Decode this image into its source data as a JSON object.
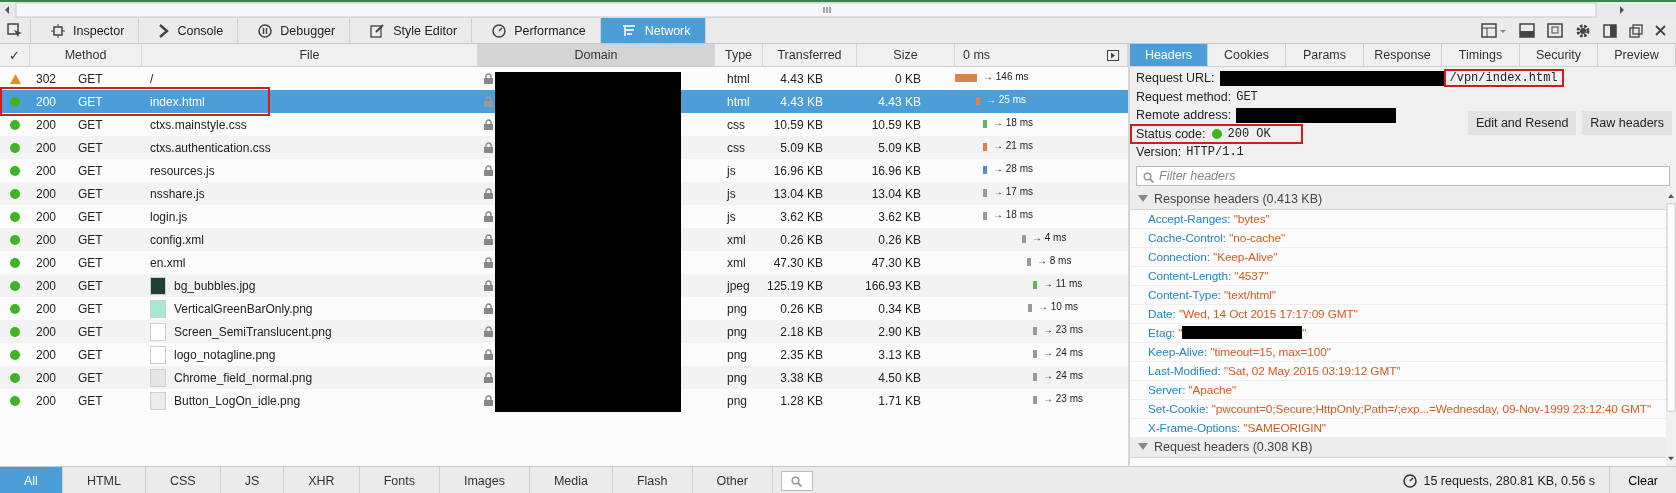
{
  "toolbar": {
    "tabs": [
      {
        "label": "Inspector",
        "selected": false
      },
      {
        "label": "Console",
        "selected": false
      },
      {
        "label": "Debugger",
        "selected": false
      },
      {
        "label": "Style Editor",
        "selected": false
      },
      {
        "label": "Performance",
        "selected": false
      },
      {
        "label": "Network",
        "selected": true
      }
    ]
  },
  "table": {
    "columns": [
      "✓",
      "Method",
      "File",
      "Domain",
      "Type",
      "Transferred",
      "Size",
      "0 ms"
    ],
    "rows": [
      {
        "status": "302",
        "kind": "redirect",
        "method": "GET",
        "file": "/",
        "type": "html",
        "transferred": "4.43 KB",
        "size": "0 KB",
        "timing": "→ 146 ms",
        "color": "#d9834a",
        "selected": false,
        "highlighted": false
      },
      {
        "status": "200",
        "kind": "ok",
        "method": "GET",
        "file": "index.html",
        "type": "html",
        "transferred": "4.43 KB",
        "size": "4.43 KB",
        "timing": "→ 25 ms",
        "color": "#d9834a",
        "selected": true,
        "highlighted": true
      },
      {
        "status": "200",
        "kind": "ok",
        "method": "GET",
        "file": "ctxs.mainstyle.css",
        "type": "css",
        "transferred": "10.59 KB",
        "size": "10.59 KB",
        "timing": "→ 18 ms",
        "color": "#5fb85c",
        "selected": false,
        "highlighted": false
      },
      {
        "status": "200",
        "kind": "ok",
        "method": "GET",
        "file": "ctxs.authentication.css",
        "type": "css",
        "transferred": "5.09 KB",
        "size": "5.09 KB",
        "timing": "→ 21 ms",
        "color": "#d9834a",
        "selected": false,
        "highlighted": false
      },
      {
        "status": "200",
        "kind": "ok",
        "method": "GET",
        "file": "resources.js",
        "type": "js",
        "transferred": "16.96 KB",
        "size": "16.96 KB",
        "timing": "→ 28 ms",
        "color": "#4f8fd0",
        "selected": false,
        "highlighted": false
      },
      {
        "status": "200",
        "kind": "ok",
        "method": "GET",
        "file": "nsshare.js",
        "type": "js",
        "transferred": "13.04 KB",
        "size": "13.04 KB",
        "timing": "→ 17 ms",
        "color": "#999999",
        "selected": false,
        "highlighted": false
      },
      {
        "status": "200",
        "kind": "ok",
        "method": "GET",
        "file": "login.js",
        "type": "js",
        "transferred": "3.62 KB",
        "size": "3.62 KB",
        "timing": "→ 18 ms",
        "color": "#999999",
        "selected": false,
        "highlighted": false
      },
      {
        "status": "200",
        "kind": "ok",
        "method": "GET",
        "file": "config.xml",
        "type": "xml",
        "transferred": "0.26 KB",
        "size": "0.26 KB",
        "timing": "→ 4 ms",
        "color": "#999999",
        "selected": false,
        "highlighted": false
      },
      {
        "status": "200",
        "kind": "ok",
        "method": "GET",
        "file": "en.xml",
        "type": "xml",
        "transferred": "47.30 KB",
        "size": "47.30 KB",
        "timing": "→ 8 ms",
        "color": "#999999",
        "selected": false,
        "highlighted": false
      },
      {
        "status": "200",
        "kind": "ok",
        "method": "GET",
        "file": "bg_bubbles.jpg",
        "thumbnail": {
          "color": "#1e4038"
        },
        "type": "jpeg",
        "transferred": "125.19 KB",
        "size": "166.93 KB",
        "timing": "→ 11 ms",
        "color": "#5fb85c",
        "selected": false,
        "highlighted": false
      },
      {
        "status": "200",
        "kind": "ok",
        "method": "GET",
        "file": "VerticalGreenBarOnly.png",
        "thumbnail": {
          "color": "#a8e8d2"
        },
        "type": "png",
        "transferred": "0.26 KB",
        "size": "0.34 KB",
        "timing": "→ 10 ms",
        "color": "#999999",
        "selected": false,
        "highlighted": false
      },
      {
        "status": "200",
        "kind": "ok",
        "method": "GET",
        "file": "Screen_SemiTranslucent.png",
        "thumbnail": {
          "color": "#ffffff"
        },
        "type": "png",
        "transferred": "2.18 KB",
        "size": "2.90 KB",
        "timing": "→ 23 ms",
        "color": "#999999",
        "selected": false,
        "highlighted": false
      },
      {
        "status": "200",
        "kind": "ok",
        "method": "GET",
        "file": "logo_notagline.png",
        "thumbnail": {
          "color": "#ffffff"
        },
        "type": "png",
        "transferred": "2.35 KB",
        "size": "3.13 KB",
        "timing": "→ 24 ms",
        "color": "#999999",
        "selected": false,
        "highlighted": false
      },
      {
        "status": "200",
        "kind": "ok",
        "method": "GET",
        "file": "Chrome_field_normal.png",
        "thumbnail": {
          "color": "#e6e6e6"
        },
        "type": "png",
        "transferred": "3.38 KB",
        "size": "4.50 KB",
        "timing": "→ 24 ms",
        "color": "#999999",
        "selected": false,
        "highlighted": false
      },
      {
        "status": "200",
        "kind": "ok",
        "method": "GET",
        "file": "Button_LogOn_idle.png",
        "thumbnail": {
          "color": "#ececec"
        },
        "type": "png",
        "transferred": "1.28 KB",
        "size": "1.71 KB",
        "timing": "→ 23 ms",
        "color": "#999999",
        "selected": false,
        "highlighted": false
      }
    ]
  },
  "filters": [
    {
      "label": "All",
      "selected": true
    },
    {
      "label": "HTML",
      "selected": false
    },
    {
      "label": "CSS",
      "selected": false
    },
    {
      "label": "JS",
      "selected": false
    },
    {
      "label": "XHR",
      "selected": false
    },
    {
      "label": "Fonts",
      "selected": false
    },
    {
      "label": "Images",
      "selected": false
    },
    {
      "label": "Media",
      "selected": false
    },
    {
      "label": "Flash",
      "selected": false
    },
    {
      "label": "Other",
      "selected": false
    }
  ],
  "details": {
    "tabs": [
      {
        "label": "Headers",
        "selected": true
      },
      {
        "label": "Cookies",
        "selected": false
      },
      {
        "label": "Params",
        "selected": false
      },
      {
        "label": "Response",
        "selected": false
      },
      {
        "label": "Timings",
        "selected": false
      },
      {
        "label": "Security",
        "selected": false
      },
      {
        "label": "Preview",
        "selected": false
      }
    ],
    "request_url": {
      "label": "Request URL:",
      "value": "/vpn/index.html",
      "highlighted": true
    },
    "request_method": {
      "label": "Request method:",
      "value": "GET"
    },
    "remote_address": {
      "label": "Remote address:"
    },
    "status_code": {
      "label": "Status code:",
      "value": "200 OK",
      "highlighted": true
    },
    "version": {
      "label": "Version:",
      "value": "HTTP/1.1"
    },
    "buttons": [
      "Edit and Resend",
      "Raw headers"
    ],
    "filter": {
      "placeholder": "Filter headers"
    },
    "response_headers": {
      "title": "Response headers (0.413 KB)",
      "expanded": true,
      "items": [
        {
          "name": "Accept-Ranges:",
          "value": "\"bytes\""
        },
        {
          "name": "Cache-Control:",
          "value": "\"no-cache\""
        },
        {
          "name": "Connection:",
          "value": "\"Keep-Alive\""
        },
        {
          "name": "Content-Length:",
          "value": "\"4537\""
        },
        {
          "name": "Content-Type:",
          "value": "\"text/html\""
        },
        {
          "name": "Date:",
          "value": "\"Wed, 14 Oct 2015 17:17:09 GMT\""
        },
        {
          "name": "Etag:",
          "value": "\"",
          "value_end": "\"",
          "redacted": true
        },
        {
          "name": "Keep-Alive:",
          "value": "\"timeout=15, max=100\""
        },
        {
          "name": "Last-Modified:",
          "value": "\"Sat, 02 May 2015 03:19:12 GMT\""
        },
        {
          "name": "Server:",
          "value": "\"Apache\""
        },
        {
          "name": "Set-Cookie:",
          "value": "\"pwcount=0;Secure;HttpOnly;Path=/;exp...=Wednesday, 09-Nov-1999 23:12:40 GMT\""
        },
        {
          "name": "X-Frame-Options:",
          "value": "\"SAMEORIGIN\""
        }
      ]
    },
    "request_headers": {
      "title": "Request headers (0.308 KB)",
      "expanded": true
    }
  },
  "summary": "15 requests, 280.81 KB, 0.56 s",
  "clear_button": "Clear"
}
